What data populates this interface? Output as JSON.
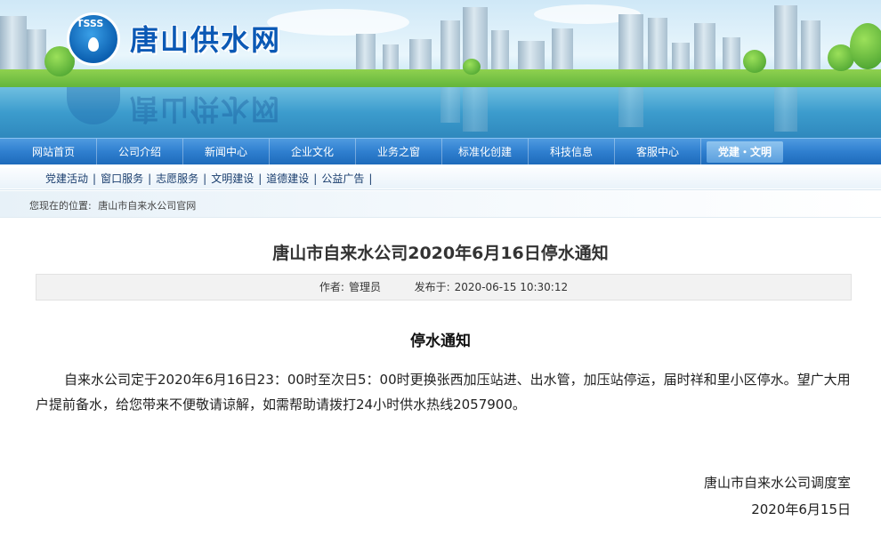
{
  "header": {
    "logo_text": "TSSS",
    "site_title": "唐山供水网"
  },
  "main_nav": {
    "items": [
      "网站首页",
      "公司介绍",
      "新闻中心",
      "企业文化",
      "业务之窗",
      "标准化创建",
      "科技信息",
      "客服中心",
      "党建・文明"
    ],
    "active_index": 8
  },
  "sub_nav": {
    "items": [
      "党建活动",
      "窗口服务",
      "志愿服务",
      "文明建设",
      "道德建设",
      "公益广告"
    ]
  },
  "breadcrumb": {
    "label": "您现在的位置:",
    "path": "唐山市自来水公司官网"
  },
  "article": {
    "title": "唐山市自来水公司2020年6月16日停水通知",
    "author_label": "作者:",
    "author": "管理员",
    "published_label": "发布于:",
    "published": "2020-06-15 10:30:12",
    "heading": "停水通知",
    "body": "自来水公司定于2020年6月16日23：00时至次日5：00时更换张西加压站进、出水管，加压站停运，届时祥和里小区停水。望广大用户提前备水，给您带来不便敬请谅解，如需帮助请拨打24小时供水热线2057900。",
    "signature": "唐山市自来水公司调度室",
    "date": "2020年6月15日"
  },
  "colors": {
    "nav_bg": "#2f7fcf",
    "title_blue": "#0b59b5",
    "meta_bg": "#f2f2f2"
  }
}
